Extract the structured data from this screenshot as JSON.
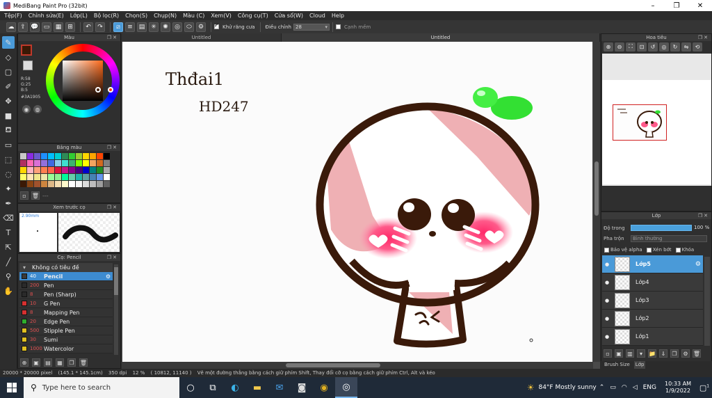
{
  "window": {
    "title": "MediBang Paint Pro (32bit)",
    "controls": [
      "–",
      "❐",
      "✕"
    ]
  },
  "menu": [
    "Tệp(F)",
    "Chỉnh sửa(E)",
    "Lớp(L)",
    "Bộ lọc(R)",
    "Chọn(S)",
    "Chụp(N)",
    "Màu (C)",
    "Xem(V)",
    "Công cụ(T)",
    "Cửa sổ(W)",
    "Cloud",
    "Help"
  ],
  "toolbar": {
    "antialias_label": "Khử răng cưa",
    "correction_label": "Điều chỉnh",
    "correction_value": "28",
    "soft_edge_label": "Cạnh mềm"
  },
  "panels": {
    "color": "Màu",
    "palette": "Bảng màu",
    "brush_preview": "Xem trước cọ",
    "brush": "Cọ: Pencil",
    "navigator": "Hoa tiêu",
    "layer": "Lớp"
  },
  "color": {
    "foreground_hex": "#3A1905",
    "r": "R:58",
    "g": "G:25",
    "b": "B:5",
    "hex_label": "#3A1905"
  },
  "palette_colors": [
    "#c8c8c8",
    "#8a2be2",
    "#6a5acd",
    "#1e90ff",
    "#00bfff",
    "#00ced1",
    "#2e8b57",
    "#32cd32",
    "#9acd32",
    "#ffd700",
    "#ffa500",
    "#ff4500",
    "#000000",
    "#b03060",
    "#ff69b4",
    "#da70d6",
    "#9370db",
    "#4169e1",
    "#87ceeb",
    "#40e0d0",
    "#3cb371",
    "#7fff00",
    "#ffff00",
    "#f4a460",
    "#d2691e",
    "#808080",
    "#ffd700",
    "#ffb6c1",
    "#ffa07a",
    "#ff7f50",
    "#ff6347",
    "#dc143c",
    "#c71585",
    "#8b008b",
    "#4b0082",
    "#0000cd",
    "#008080",
    "#228b22",
    "#a9a9a9",
    "#ffff66",
    "#ffe4b5",
    "#f0e68c",
    "#eee8aa",
    "#98fb98",
    "#90ee90",
    "#00fa9a",
    "#66cdaa",
    "#20b2aa",
    "#5f9ea0",
    "#4682b4",
    "#6495ed",
    "#ffffff",
    "#3A1905",
    "#8b4513",
    "#a0522d",
    "#cd853f",
    "#deb887",
    "#f5deb3",
    "#fffacd",
    "#ffffff",
    "#f5f5f5",
    "#dcdcdc",
    "#bdbdbd",
    "#9e9e9e",
    "#616161"
  ],
  "brush_preview": {
    "size_label": "2.90mm"
  },
  "brushes": {
    "group": "Không có tiêu đề",
    "items": [
      {
        "size": "40",
        "name": "Pencil",
        "color": "#3a3a3a",
        "selected": true
      },
      {
        "size": "200",
        "name": "Pen",
        "color": "#2a2a2a",
        "selected": false
      },
      {
        "size": "8",
        "name": "Pen (Sharp)",
        "color": "#2a2a2a",
        "selected": false
      },
      {
        "size": "10",
        "name": "G Pen",
        "color": "#d63030",
        "selected": false
      },
      {
        "size": "8",
        "name": "Mapping Pen",
        "color": "#d63030",
        "selected": false
      },
      {
        "size": "20",
        "name": "Edge Pen",
        "color": "#2eae2e",
        "selected": false
      },
      {
        "size": "500",
        "name": "Stipple Pen",
        "color": "#e0c020",
        "selected": false
      },
      {
        "size": "30",
        "name": "Sumi",
        "color": "#e0c020",
        "selected": false
      },
      {
        "size": "1000",
        "name": "Watercolor",
        "color": "#e0c020",
        "selected": false
      }
    ]
  },
  "document_tabs": [
    "Untitled",
    "Untitled"
  ],
  "canvas_text": {
    "line1": "Thđai1",
    "line2": "HD247"
  },
  "layers_panel": {
    "opacity_label": "Độ trong",
    "opacity_value": "100 %",
    "opacity_fraction": 1.0,
    "blend_label": "Pha trộn",
    "blend_value": "Bình thường",
    "protect_alpha": "Bảo vệ alpha",
    "clip": "Xén bớt",
    "lock": "Khóa",
    "layers": [
      {
        "name": "Lớp5",
        "selected": true
      },
      {
        "name": "Lớp4",
        "selected": false
      },
      {
        "name": "Lớp3",
        "selected": false
      },
      {
        "name": "Lớp2",
        "selected": false
      },
      {
        "name": "Lớp1",
        "selected": false
      }
    ]
  },
  "right_tabs": [
    "Brush Size",
    "Lớp"
  ],
  "status": {
    "canvas_size": "20000 * 20000 pixel",
    "physical_size": "(145.1 * 145.1cm)",
    "dpi": "350 dpi",
    "zoom": "12 %",
    "coords": "( 10812, 11140 )",
    "hint": "Vẽ một đường thẳng bằng cách giữ phím Shift, Thay đổi cỡ cọ bằng cách giữ phím Ctrl, Alt và kéo"
  },
  "taskbar": {
    "search_placeholder": "Type here to search",
    "weather": "84°F  Mostly sunny",
    "lang": "ENG",
    "time": "10:33 AM",
    "date": "1/9/2022",
    "notifications": "1"
  }
}
